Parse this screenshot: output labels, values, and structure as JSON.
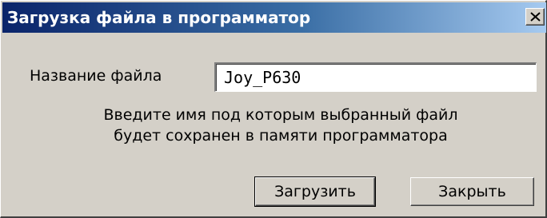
{
  "window": {
    "title": "Загрузка файла в программатор",
    "close_icon": "close-x-icon"
  },
  "form": {
    "filename_label": "Название файла",
    "filename_value": "Joy_P630",
    "hint_line1": "Введите имя под которым выбранный файл",
    "hint_line2": "будет сохранен в памяти программатора"
  },
  "buttons": {
    "load_label": "Загрузить",
    "close_label": "Закрыть"
  },
  "colors": {
    "titlebar_start": "#0a246a",
    "titlebar_end": "#a6caf0",
    "face": "#d4d0c8"
  }
}
